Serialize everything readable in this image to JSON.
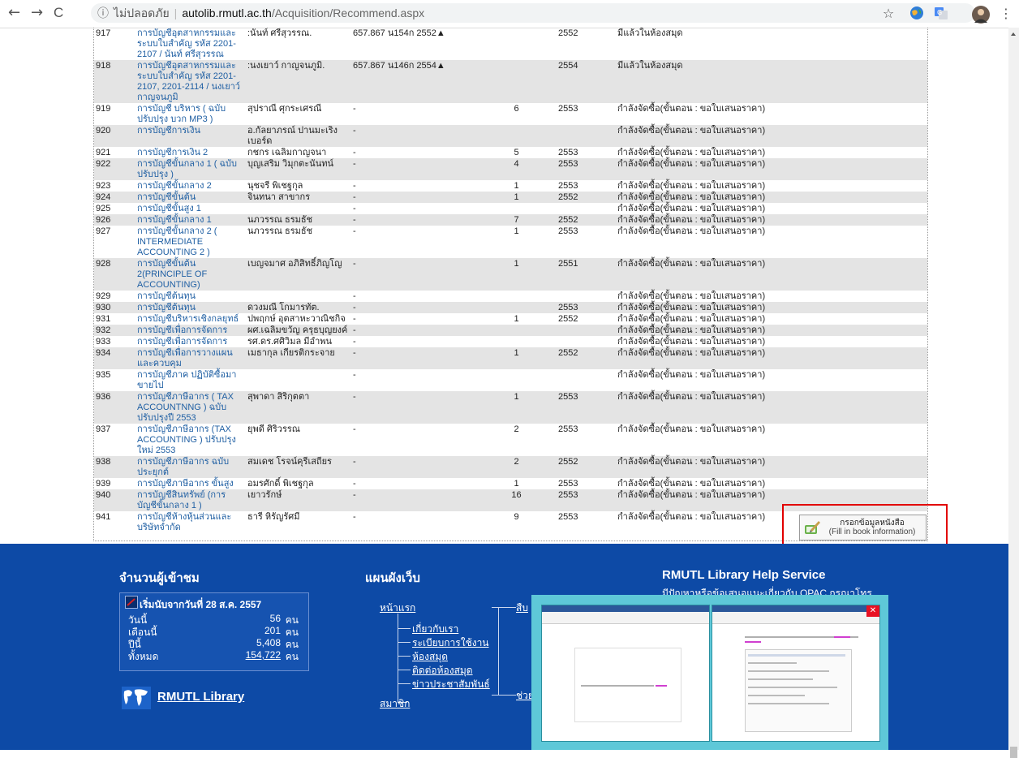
{
  "browser": {
    "back_glyph": "←",
    "forward_glyph": "→",
    "reload_glyph": "C",
    "info_glyph": "ⓘ",
    "security_text": "ไม่ปลอดภัย",
    "url_host": "autolib.rmutl.ac.th",
    "url_path": "/Acquisition/Recommend.aspx",
    "star_glyph": "☆",
    "menu_glyph": "⋮"
  },
  "rows": [
    {
      "no": "917",
      "title": "การบัญชีอุตสาหกรรมและระบบใบสำคัญ รหัส 2201-2107 / นันท์ ศรีสุวรรณ",
      "author": ":นันท์ ศรีสุวรรณ.",
      "callno": "657.867 น154ก 2552▲",
      "qty": "",
      "year": "2552",
      "status": "มีแล้วในห้องสมุด",
      "shade": false
    },
    {
      "no": "918",
      "title": "การบัญชีอุตสาหกรรมและระบบใบสำคัญ รหัส 2201-2107, 2201-2114 / นงเยาว์ กาญจนภูมิ",
      "author": ":นงเยาว์ กาญจนภูมิ.",
      "callno": "657.867 น146ก 2554▲",
      "qty": "",
      "year": "2554",
      "status": "มีแล้วในห้องสมุด",
      "shade": true
    },
    {
      "no": "919",
      "title": "การบัญชี บริหาร ( ฉบับปรับปรุง บวก MP3 )",
      "author": "สุปราณี ศุกระเศรณี",
      "callno": "-",
      "qty": "6",
      "year": "2553",
      "status": "กำลังจัดซื้อ(ขั้นตอน : ขอใบเสนอราคา)",
      "shade": false
    },
    {
      "no": "920",
      "title": "การบัญชีการเงิน",
      "author": "อ.กัลยาภรณ์ ปานมะเริง เบอร์ด",
      "callno": "-",
      "qty": "",
      "year": "",
      "status": "กำลังจัดซื้อ(ขั้นตอน : ขอใบเสนอราคา)",
      "shade": true
    },
    {
      "no": "921",
      "title": "การบัญชีการเงิน 2",
      "author": "กชกร เฉลิมกาญจนา",
      "callno": "-",
      "qty": "5",
      "year": "2553",
      "status": "กำลังจัดซื้อ(ขั้นตอน : ขอใบเสนอราคา)",
      "shade": false
    },
    {
      "no": "922",
      "title": "การบัญชีขั้นกลาง 1 ( ฉบับปรับปรุง )",
      "author": "บุญเสริม วิมุกตะนันทน์",
      "callno": "-",
      "qty": "4",
      "year": "2553",
      "status": "กำลังจัดซื้อ(ขั้นตอน : ขอใบเสนอราคา)",
      "shade": true
    },
    {
      "no": "923",
      "title": "การบัญชีขั้นกลาง 2",
      "author": "นุชจรี พิเชฐกุล",
      "callno": "-",
      "qty": "1",
      "year": "2553",
      "status": "กำลังจัดซื้อ(ขั้นตอน : ขอใบเสนอราคา)",
      "shade": false
    },
    {
      "no": "924",
      "title": "การบัญชีขั้นต้น",
      "author": "จินทนา สาขากร",
      "callno": "-",
      "qty": "1",
      "year": "2552",
      "status": "กำลังจัดซื้อ(ขั้นตอน : ขอใบเสนอราคา)",
      "shade": true
    },
    {
      "no": "925",
      "title": "การบัญชีขั้นสูง 1",
      "author": "",
      "callno": "-",
      "qty": "",
      "year": "",
      "status": "กำลังจัดซื้อ(ขั้นตอน : ขอใบเสนอราคา)",
      "shade": false
    },
    {
      "no": "926",
      "title": "การบัญชีขั้นกลาง 1",
      "author": "นภวรรณ ธรมธัช",
      "callno": "-",
      "qty": "7",
      "year": "2552",
      "status": "กำลังจัดซื้อ(ขั้นตอน : ขอใบเสนอราคา)",
      "shade": true
    },
    {
      "no": "927",
      "title": "การบัญชีขั้นกลาง 2 ( INTERMEDIATE ACCOUNTING 2 )",
      "author": "นภวรรณ ธรมธัช",
      "callno": "-",
      "qty": "1",
      "year": "2553",
      "status": "กำลังจัดซื้อ(ขั้นตอน : ขอใบเสนอราคา)",
      "shade": false
    },
    {
      "no": "928",
      "title": "การบัญชีขั้นต้น 2(PRINCIPLE OF ACCOUNTING)",
      "author": "เบญจมาศ อภิสิทธิ์ภิญโญ",
      "callno": "-",
      "qty": "1",
      "year": "2551",
      "status": "กำลังจัดซื้อ(ขั้นตอน : ขอใบเสนอราคา)",
      "shade": true
    },
    {
      "no": "929",
      "title": "การบัญชีต้นทุน",
      "author": "",
      "callno": "-",
      "qty": "",
      "year": "",
      "status": "กำลังจัดซื้อ(ขั้นตอน : ขอใบเสนอราคา)",
      "shade": false
    },
    {
      "no": "930",
      "title": "การบัญชีต้นทุน",
      "author": "ดวงมณี โกมารทัต.",
      "callno": "-",
      "qty": "",
      "year": "2553",
      "status": "กำลังจัดซื้อ(ขั้นตอน : ขอใบเสนอราคา)",
      "shade": true
    },
    {
      "no": "931",
      "title": "การบัญชีบริหารเชิงกลยุทธ์",
      "author": "ปพฤกษ์ อุตสาหะวาณิชกิจ",
      "callno": "-",
      "qty": "1",
      "year": "2552",
      "status": "กำลังจัดซื้อ(ขั้นตอน : ขอใบเสนอราคา)",
      "shade": false
    },
    {
      "no": "932",
      "title": "การบัญชีเพื่อการจัดการ",
      "author": "ผศ.เฉลิมขวัญ ครุธบุญยงค์",
      "callno": "-",
      "qty": "",
      "year": "",
      "status": "กำลังจัดซื้อ(ขั้นตอน : ขอใบเสนอราคา)",
      "shade": true
    },
    {
      "no": "933",
      "title": "การบัญชีเพื่อการจัดการ",
      "author": "รศ.ดร.ศศิวิมล มีอำพน",
      "callno": "-",
      "qty": "",
      "year": "",
      "status": "กำลังจัดซื้อ(ขั้นตอน : ขอใบเสนอราคา)",
      "shade": false
    },
    {
      "no": "934",
      "title": "การบัญชีเพื่อการวางแผนและควบคุม",
      "author": "เมธากุล เกียรติกระจาย",
      "callno": "-",
      "qty": "1",
      "year": "2552",
      "status": "กำลังจัดซื้อ(ขั้นตอน : ขอใบเสนอราคา)",
      "shade": true
    },
    {
      "no": "935",
      "title": "การบัญชีภาค ปฏิบัติซื้อมาขายไป",
      "author": "",
      "callno": "-",
      "qty": "",
      "year": "",
      "status": "กำลังจัดซื้อ(ขั้นตอน : ขอใบเสนอราคา)",
      "shade": false
    },
    {
      "no": "936",
      "title": "การบัญชีภาษีอากร ( TAX ACCOUNTNNG ) ฉบับปรับปรุงปี 2553",
      "author": "สุพาดา สิริกุตตา",
      "callno": "-",
      "qty": "1",
      "year": "2553",
      "status": "กำลังจัดซื้อ(ขั้นตอน : ขอใบเสนอราคา)",
      "shade": true
    },
    {
      "no": "937",
      "title": "การบัญชีภาษีอากร (TAX ACCOUNTING ) ปรับปรุงใหม่ 2553",
      "author": "ยุพดี ศิริวรรณ",
      "callno": "-",
      "qty": "2",
      "year": "2553",
      "status": "กำลังจัดซื้อ(ขั้นตอน : ขอใบเสนอราคา)",
      "shade": false
    },
    {
      "no": "938",
      "title": "การบัญชีภาษีอากร ฉบับประยุกต์",
      "author": "สมเดช โรจน์คุรีเสถียร",
      "callno": "-",
      "qty": "2",
      "year": "2552",
      "status": "กำลังจัดซื้อ(ขั้นตอน : ขอใบเสนอราคา)",
      "shade": true
    },
    {
      "no": "939",
      "title": "การบัญชีภาษีอากร ขั้นสูง",
      "author": "อมรศักดิ์ พิเชฐกุล",
      "callno": "-",
      "qty": "1",
      "year": "2553",
      "status": "กำลังจัดซื้อ(ขั้นตอน : ขอใบเสนอราคา)",
      "shade": false
    },
    {
      "no": "940",
      "title": "การบัญชีสินทรัพย์ (การบัญชีขั้นกลาง 1 )",
      "author": "เยาวรักษ์",
      "callno": "-",
      "qty": "16",
      "year": "2553",
      "status": "กำลังจัดซื้อ(ขั้นตอน : ขอใบเสนอราคา)",
      "shade": true
    },
    {
      "no": "941",
      "title": "การบัญชีห้างหุ้นส่วนและบริษัทจำกัด",
      "author": "ธารี หิรัญรัศมี",
      "callno": "-",
      "qty": "9",
      "year": "2553",
      "status": "กำลังจัดซื้อ(ขั้นตอน : ขอใบเสนอราคา)",
      "shade": false
    }
  ],
  "fill_button": {
    "label_th": "กรอกข้อมูลหนังสือ",
    "label_en": "(Fill in book information)"
  },
  "footer": {
    "visitors_title": "จำนวนผู้เข้าชม",
    "start_text": "เริ่มนับจากวันที่ 28 ส.ค. 2557",
    "stats": [
      {
        "label": "วันนี้",
        "value": "56",
        "unit": "คน"
      },
      {
        "label": "เดือนนี้",
        "value": "201",
        "unit": "คน"
      },
      {
        "label": "ปีนี้",
        "value": "5,408",
        "unit": "คน"
      },
      {
        "label": "ทั้งหมด",
        "value": "154,722",
        "unit": "คน"
      }
    ],
    "library_link": "RMUTL Library",
    "sitemap_title": "แผนผังเว็บ",
    "home_link": "หน้าแรก",
    "sub_links": [
      "เกี่ยวกับเรา",
      "ระเบียบการใช้งาน",
      "ห้องสมุด",
      "ติดต่อห้องสมุด",
      "ข่าวประชาสัมพันธ์"
    ],
    "member_link": "สมาชิก",
    "col2_top": "สืบ",
    "col2_bottom": "ช่วย",
    "help_title": "RMUTL Library Help Service",
    "help_text": "มีปัญหาหรือข้อเสนอแนะเกี่ยวกับ OPAC กรุณาโทร"
  },
  "taskbar_preview": {
    "close_glyph": "✕"
  }
}
